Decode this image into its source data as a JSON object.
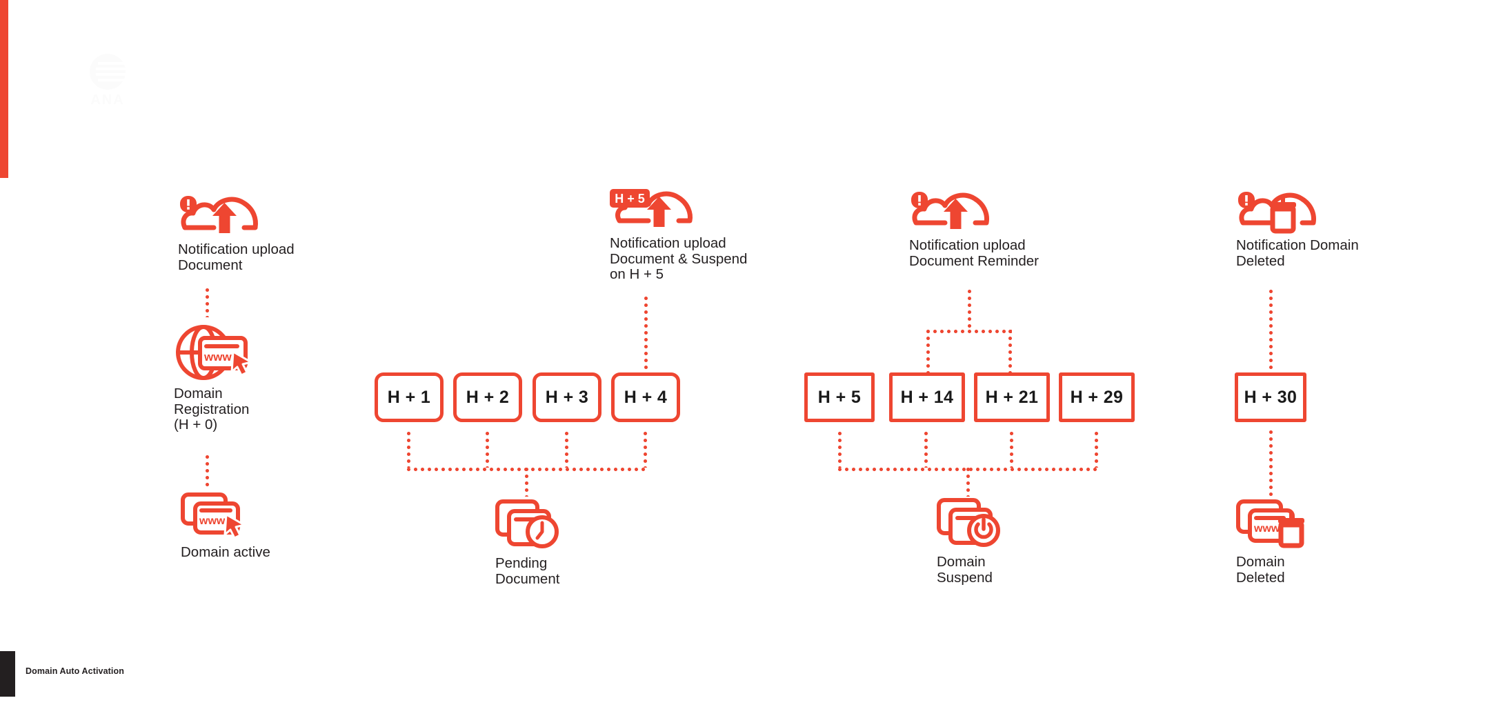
{
  "brand": {
    "accent_color": "#EE4631",
    "dark_color": "#231F20",
    "watermark_text": "ANA"
  },
  "footer": {
    "label": "Domain Auto Activation"
  },
  "diagram_data": {
    "type": "timeline-flow",
    "title": "Domain Auto Activation",
    "columns": [
      {
        "id": "registration",
        "nodes": [
          {
            "id": "notif-upload-doc",
            "icon": "cloud-upload-alert-icon",
            "label": "Notification upload\nDocument",
            "badge": ""
          },
          {
            "id": "domain-registration",
            "icon": "globe-www-cursor-icon",
            "label": "Domain\nRegistration\n(H + 0)"
          },
          {
            "id": "domain-active",
            "icon": "windows-www-cursor-icon",
            "label": "Domain active"
          }
        ]
      },
      {
        "id": "pending",
        "notification": {
          "id": "notif-upload-suspend",
          "icon": "cloud-upload-badge-icon",
          "badge": "H + 5",
          "label": "Notification upload\nDocument & Suspend\non H + 5"
        },
        "boxes": [
          "H + 1",
          "H + 2",
          "H + 3",
          "H + 4"
        ],
        "outcome": {
          "id": "pending-document",
          "icon": "windows-clock-icon",
          "label": "Pending\nDocument"
        }
      },
      {
        "id": "suspend",
        "notification": {
          "id": "notif-upload-reminder",
          "icon": "cloud-upload-alert-icon",
          "label": "Notification upload\nDocument Reminder"
        },
        "boxes": [
          "H + 5",
          "H + 14",
          "H + 21",
          "H + 29"
        ],
        "outcome": {
          "id": "domain-suspend",
          "icon": "windows-power-icon",
          "label": "Domain\nSuspend"
        }
      },
      {
        "id": "deleted",
        "notification": {
          "id": "notif-domain-deleted",
          "icon": "cloud-trash-alert-icon",
          "label": "Notification Domain\nDeleted"
        },
        "boxes": [
          "H + 30"
        ],
        "outcome": {
          "id": "domain-deleted",
          "icon": "windows-www-trash-icon",
          "label": "Domain\nDeleted"
        }
      }
    ]
  }
}
